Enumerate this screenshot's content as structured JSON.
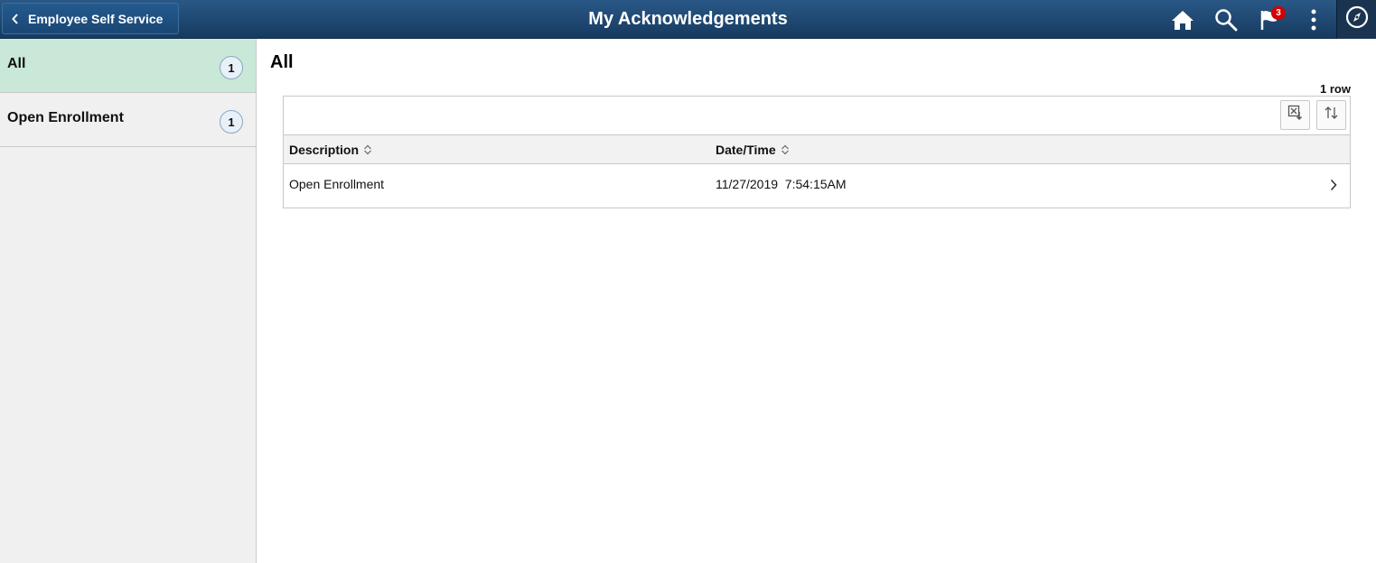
{
  "header": {
    "back_label": "Employee Self Service",
    "title": "My Acknowledgements",
    "icons": [
      "home-icon",
      "search-icon",
      "notifications-flag-icon",
      "actions-menu-icon",
      "navbar-compass-icon"
    ],
    "notification_count": "3"
  },
  "sidebar": {
    "items": [
      {
        "label": "All",
        "count": "1",
        "active": true
      },
      {
        "label": "Open Enrollment",
        "count": "1",
        "active": false
      }
    ]
  },
  "main": {
    "title": "All",
    "row_count": "1 row",
    "toolbar_icons": [
      "download-excel-icon",
      "sort-icon"
    ],
    "columns": [
      "Description",
      "Date/Time"
    ],
    "rows": [
      {
        "description": "Open Enrollment",
        "datetime": "11/27/2019  7:54:15AM"
      }
    ]
  },
  "colors": {
    "header_dark": "#163a60",
    "header_light": "#2a5886",
    "active_item": "#c9e8d7",
    "sidebar_bg": "#f0f0f0",
    "badge": "#d40000"
  }
}
